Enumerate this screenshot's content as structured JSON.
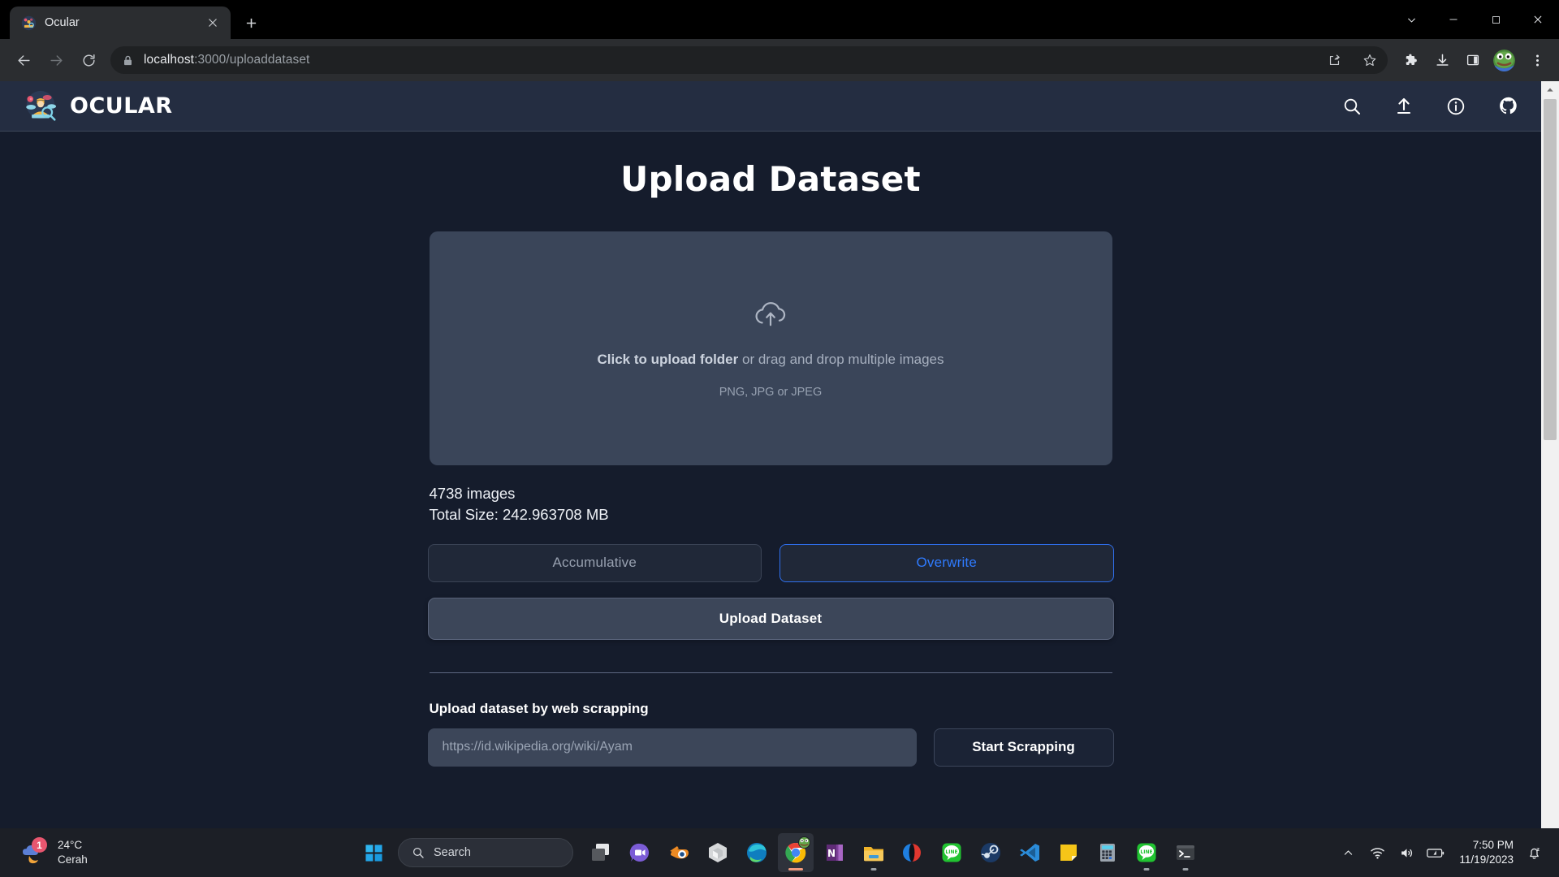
{
  "browser": {
    "tab": {
      "title": "Ocular",
      "favicon": "ocular-favicon",
      "close_label": "✕"
    },
    "new_tab_label": "+",
    "window_controls": {
      "minimize": "—",
      "maximize": "☐",
      "close": "✕",
      "chevron": "⌄"
    },
    "nav": {
      "back": "←",
      "forward": "→",
      "reload": "↻"
    },
    "omnibox": {
      "scheme_host": "localhost",
      "path": ":3000/uploaddataset",
      "full_url": "localhost:3000/uploaddataset",
      "lock_icon": "lock-icon",
      "share_icon": "share-icon",
      "bookmark_icon": "star-icon"
    },
    "toolbar_icons": [
      "extensions-icon",
      "downloads-icon",
      "sidebar-icon",
      "profile-avatar",
      "more-menu-icon"
    ]
  },
  "app": {
    "brand": "OCULAR",
    "header_icons": [
      "search-icon",
      "upload-icon",
      "info-icon",
      "github-icon"
    ]
  },
  "main": {
    "title": "Upload Dataset",
    "dropzone": {
      "icon": "cloud-upload-icon",
      "primary_bold": "Click to upload folder",
      "primary_rest": " or drag and drop multiple images",
      "formats": "PNG, JPG or JPEG"
    },
    "stats": {
      "images": "4738 images",
      "total_size": "Total Size: 242.963708 MB"
    },
    "modes": [
      {
        "label": "Accumulative",
        "active": false
      },
      {
        "label": "Overwrite",
        "active": true
      }
    ],
    "upload_button": "Upload Dataset",
    "scraping": {
      "label": "Upload dataset by web scrapping",
      "input_value": "",
      "input_placeholder": "https://id.wikipedia.org/wiki/Ayam",
      "button": "Start Scrapping"
    }
  },
  "colors": {
    "page_bg": "#151c2c",
    "appbar_bg": "#242d41",
    "dropzone_bg": "#3a4559",
    "accent_blue": "#2f7bff",
    "text_primary": "#ffffff",
    "text_muted": "#98a1b0"
  },
  "taskbar": {
    "weather": {
      "temp": "24°C",
      "condition": "Cerah",
      "badge": "1"
    },
    "search_placeholder": "Search",
    "apps": [
      "task-view-icon",
      "chat-icon",
      "blender-icon",
      "unity-icon",
      "edge-icon",
      "chrome-icon",
      "onenote-icon",
      "file-explorer-icon",
      "dia-browser-icon",
      "line-icon",
      "steam-icon",
      "vscode-icon",
      "sticky-notes-icon",
      "calculator-icon",
      "line-app-icon",
      "terminal-icon"
    ],
    "tray_icons": [
      "chevron-up-icon",
      "wifi-icon",
      "volume-icon",
      "battery-icon",
      "notifications-icon"
    ],
    "time": "7:50 PM",
    "date": "11/19/2023"
  }
}
